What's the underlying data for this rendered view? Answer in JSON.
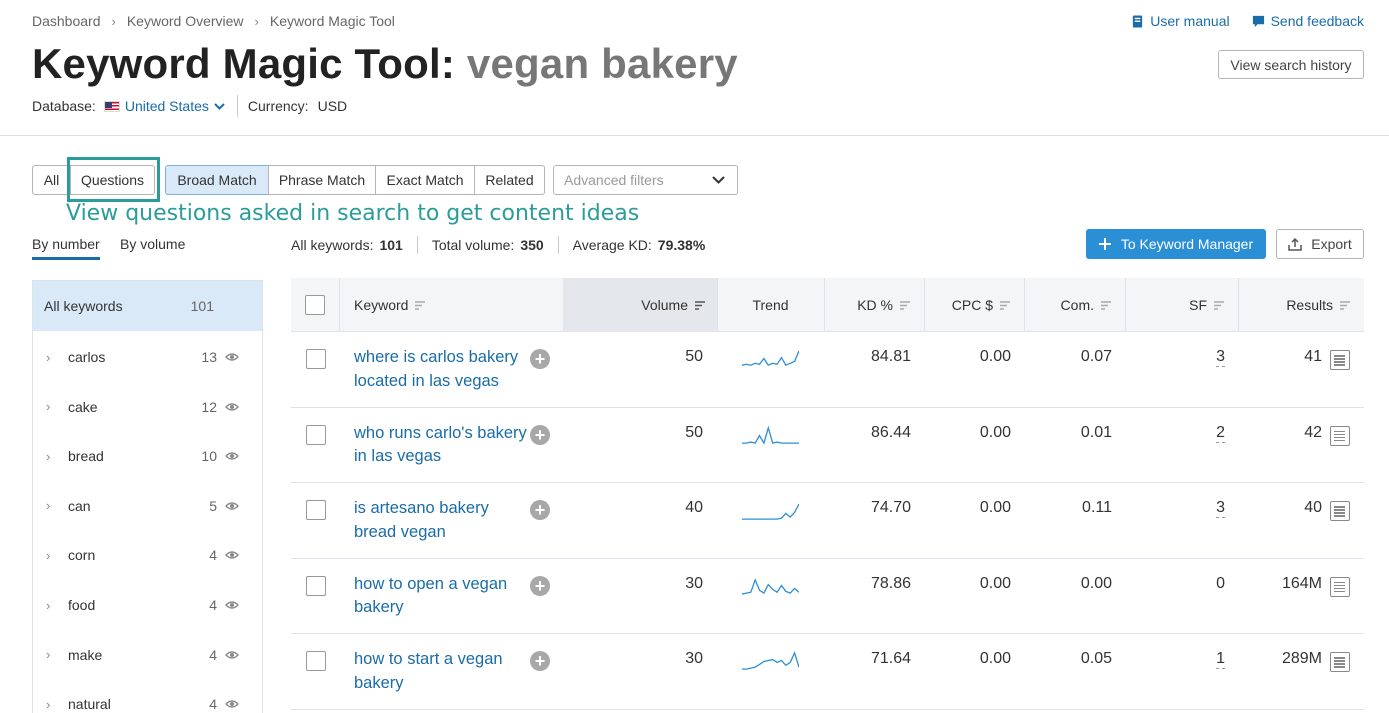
{
  "breadcrumb": [
    "Dashboard",
    "Keyword Overview",
    "Keyword Magic Tool"
  ],
  "top_links": {
    "manual": "User manual",
    "feedback": "Send feedback"
  },
  "title": {
    "prefix": "Keyword Magic Tool:",
    "query": "vegan bakery"
  },
  "history_button": "View search history",
  "database": {
    "label": "Database:",
    "value": "United States",
    "currency_label": "Currency:",
    "currency_value": "USD"
  },
  "filters": {
    "all": "All",
    "questions": "Questions",
    "matches": [
      "Broad Match",
      "Phrase Match",
      "Exact Match",
      "Related"
    ],
    "advanced": "Advanced filters"
  },
  "annotation": "View questions asked in search to get content ideas",
  "sort_tabs": {
    "by_number": "By number",
    "by_volume": "By volume"
  },
  "stats": {
    "all_keywords_label": "All keywords:",
    "all_keywords": "101",
    "total_volume_label": "Total volume:",
    "total_volume": "350",
    "avg_kd_label": "Average KD:",
    "avg_kd": "79.38%"
  },
  "buttons": {
    "keyword_manager": "To Keyword Manager",
    "export": "Export"
  },
  "sidebar": {
    "all": {
      "label": "All keywords",
      "count": "101"
    },
    "items": [
      {
        "label": "carlos",
        "count": "13"
      },
      {
        "label": "cake",
        "count": "12"
      },
      {
        "label": "bread",
        "count": "10"
      },
      {
        "label": "can",
        "count": "5"
      },
      {
        "label": "corn",
        "count": "4"
      },
      {
        "label": "food",
        "count": "4"
      },
      {
        "label": "make",
        "count": "4"
      },
      {
        "label": "natural",
        "count": "4"
      }
    ]
  },
  "table": {
    "headers": {
      "keyword": "Keyword",
      "volume": "Volume",
      "trend": "Trend",
      "kd": "KD %",
      "cpc": "CPC $",
      "com": "Com.",
      "sf": "SF",
      "results": "Results"
    },
    "rows": [
      {
        "keyword": "where is carlos bakery located in las vegas",
        "volume": "50",
        "kd": "84.81",
        "cpc": "0.00",
        "com": "0.07",
        "sf": "3",
        "results": "41",
        "trend": [
          0.2,
          0.25,
          0.2,
          0.3,
          0.25,
          0.55,
          0.2,
          0.3,
          0.25,
          0.6,
          0.2,
          0.3,
          0.4,
          0.95
        ]
      },
      {
        "keyword": "who runs carlo's bakery in las vegas",
        "volume": "50",
        "kd": "86.44",
        "cpc": "0.00",
        "com": "0.01",
        "sf": "2",
        "results": "42",
        "trend": [
          0.1,
          0.1,
          0.15,
          0.1,
          0.5,
          0.1,
          0.9,
          0.1,
          0.15,
          0.1,
          0.1,
          0.1,
          0.1,
          0.1
        ]
      },
      {
        "keyword": "is artesano bakery bread vegan",
        "volume": "40",
        "kd": "74.70",
        "cpc": "0.00",
        "com": "0.11",
        "sf": "3",
        "results": "40",
        "trend": [
          0.05,
          0.05,
          0.05,
          0.05,
          0.05,
          0.05,
          0.05,
          0.05,
          0.05,
          0.1,
          0.35,
          0.15,
          0.4,
          0.85
        ]
      },
      {
        "keyword": "how to open a vegan bakery",
        "volume": "30",
        "kd": "78.86",
        "cpc": "0.00",
        "com": "0.00",
        "sf": "0",
        "results": "164M",
        "trend": [
          0.1,
          0.15,
          0.2,
          0.85,
          0.3,
          0.15,
          0.6,
          0.35,
          0.2,
          0.55,
          0.25,
          0.15,
          0.4,
          0.2
        ]
      },
      {
        "keyword": "how to start a vegan bakery",
        "volume": "30",
        "kd": "71.64",
        "cpc": "0.00",
        "com": "0.05",
        "sf": "1",
        "results": "289M",
        "trend": [
          0.1,
          0.1,
          0.15,
          0.2,
          0.35,
          0.5,
          0.55,
          0.6,
          0.45,
          0.55,
          0.3,
          0.45,
          0.95,
          0.2
        ]
      }
    ]
  },
  "colors": {
    "accent": "#1a6ca8",
    "primary_button": "#2b8fd6",
    "annotation": "#2a9d9a",
    "selected_bg": "#d9e9f7",
    "trend_line": "#2b8fd6"
  }
}
